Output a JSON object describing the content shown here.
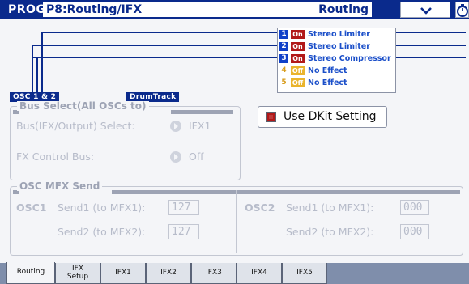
{
  "header": {
    "mode": "PROG",
    "page_title": "P8:Routing/IFX",
    "section": "Routing",
    "menu_icon": "chevron-down-icon",
    "timer_icon": "stopwatch-icon"
  },
  "routing": {
    "source_labels": [
      "OSC 1 & 2",
      "DrumTrack"
    ],
    "ifx": [
      {
        "num": "1",
        "state": "On",
        "name": "Stereo Limiter"
      },
      {
        "num": "2",
        "state": "On",
        "name": "Stereo Limiter"
      },
      {
        "num": "3",
        "state": "On",
        "name": "Stereo Compressor"
      },
      {
        "num": "4",
        "state": "Off",
        "name": "No Effect"
      },
      {
        "num": "5",
        "state": "Off",
        "name": "No Effect"
      }
    ]
  },
  "bus_select": {
    "title": "Bus Select(All OSCs to)",
    "bus_label": "Bus(IFX/Output) Select:",
    "bus_value": "IFX1",
    "fx_label": "FX Control Bus:",
    "fx_value": "Off"
  },
  "dkit": {
    "label": "Use DKit Setting",
    "checked": true
  },
  "osc_mfx": {
    "title": "OSC MFX Send",
    "osc1": {
      "name": "OSC1",
      "send1_label": "Send1 (to MFX1):",
      "send1_value": "127",
      "send2_label": "Send2 (to MFX2):",
      "send2_value": "127"
    },
    "osc2": {
      "name": "OSC2",
      "send1_label": "Send1 (to MFX1):",
      "send1_value": "000",
      "send2_label": "Send2 (to MFX2):",
      "send2_value": "000"
    }
  },
  "tabs": [
    {
      "label": "Routing",
      "label2": "",
      "active": true
    },
    {
      "label": "IFX",
      "label2": "Setup",
      "active": false
    },
    {
      "label": "IFX1",
      "label2": "",
      "active": false
    },
    {
      "label": "IFX2",
      "label2": "",
      "active": false
    },
    {
      "label": "IFX3",
      "label2": "",
      "active": false
    },
    {
      "label": "IFX4",
      "label2": "",
      "active": false
    },
    {
      "label": "IFX5",
      "label2": "",
      "active": false
    }
  ],
  "colors": {
    "title_bar": "#0a2a8c",
    "on_badge": "#b21919",
    "off_badge": "#eab42c",
    "effect_text": "#1b4fc9",
    "dim_text": "#b7bcca"
  }
}
